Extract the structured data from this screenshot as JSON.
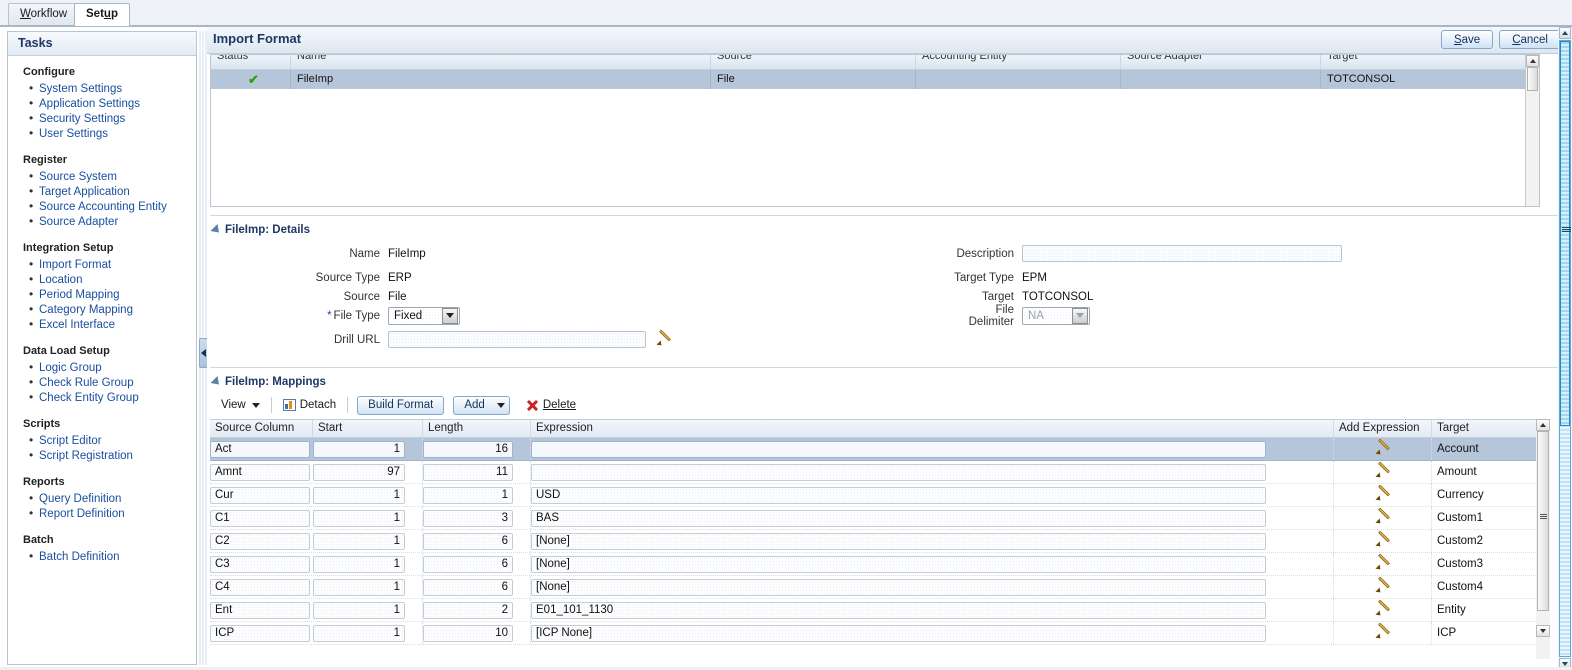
{
  "tabs": [
    {
      "pre": "W",
      "acc": "",
      "label": "Workflow",
      "full": "Workflow",
      "selected": false
    },
    {
      "label": "Setup",
      "selected": true
    }
  ],
  "tab_workflow": {
    "a": "W",
    "b": "orkflow"
  },
  "tab_setup": {
    "a": "Set",
    "b": "u",
    "c": "p"
  },
  "sidebar": {
    "title": "Tasks",
    "groups": [
      {
        "heading": "Configure",
        "items": [
          "System Settings",
          "Application Settings",
          "Security Settings",
          "User Settings"
        ]
      },
      {
        "heading": "Register",
        "items": [
          "Source System",
          "Target Application",
          "Source Accounting Entity",
          "Source Adapter"
        ]
      },
      {
        "heading": "Integration Setup",
        "items": [
          "Import Format",
          "Location",
          "Period Mapping",
          "Category Mapping",
          "Excel Interface"
        ]
      },
      {
        "heading": "Data Load Setup",
        "items": [
          "Logic Group",
          "Check Rule Group",
          "Check Entity Group"
        ]
      },
      {
        "heading": "Scripts",
        "items": [
          "Script Editor",
          "Script Registration"
        ]
      },
      {
        "heading": "Reports",
        "items": [
          "Query Definition",
          "Report Definition"
        ]
      },
      {
        "heading": "Batch",
        "items": [
          "Batch Definition"
        ]
      }
    ]
  },
  "header": {
    "title": "Import Format",
    "save": {
      "a": "S",
      "b": "ave"
    },
    "cancel": {
      "a": "C",
      "b": "ancel"
    }
  },
  "master_grid": {
    "columns": [
      "Status",
      "Name",
      "Source",
      "Accounting Entity",
      "Source Adapter",
      "Target"
    ],
    "rows": [
      {
        "status": "ok",
        "name": "FileImp",
        "source": "File",
        "accounting_entity": "",
        "source_adapter": "",
        "target": "TOTCONSOL",
        "selected": true
      }
    ]
  },
  "details": {
    "section_title": "FileImp: Details",
    "left": {
      "name_label": "Name",
      "name_value": "FileImp",
      "source_type_label": "Source Type",
      "source_type_value": "ERP",
      "source_label": "Source",
      "source_value": "File",
      "file_type_label": "File Type",
      "file_type_value": "Fixed",
      "file_type_required": "*",
      "drill_url_label": "Drill URL",
      "drill_url_value": ""
    },
    "right": {
      "description_label": "Description",
      "description_value": "",
      "target_type_label": "Target Type",
      "target_type_value": "EPM",
      "target_label": "Target",
      "target_value": "TOTCONSOL",
      "file_delimiter_label": "File Delimiter",
      "file_delimiter_value": "NA"
    }
  },
  "mappings": {
    "section_title": "FileImp: Mappings",
    "toolbar": {
      "view": "View",
      "detach": "Detach",
      "build_format": "Build Format",
      "add": "Add",
      "delete": "Delete"
    },
    "columns": [
      "Source Column",
      "Start",
      "Length",
      "Expression",
      "Add Expression",
      "Target"
    ],
    "rows": [
      {
        "source_column": "Act",
        "start": "1",
        "length": "16",
        "expression": "",
        "target": "Account",
        "selected": true
      },
      {
        "source_column": "Amnt",
        "start": "97",
        "length": "11",
        "expression": "",
        "target": "Amount",
        "selected": false
      },
      {
        "source_column": "Cur",
        "start": "1",
        "length": "1",
        "expression": "USD",
        "target": "Currency",
        "selected": false
      },
      {
        "source_column": "C1",
        "start": "1",
        "length": "3",
        "expression": "BAS",
        "target": "Custom1",
        "selected": false
      },
      {
        "source_column": "C2",
        "start": "1",
        "length": "6",
        "expression": "[None]",
        "target": "Custom2",
        "selected": false
      },
      {
        "source_column": "C3",
        "start": "1",
        "length": "6",
        "expression": "[None]",
        "target": "Custom3",
        "selected": false
      },
      {
        "source_column": "C4",
        "start": "1",
        "length": "6",
        "expression": "[None]",
        "target": "Custom4",
        "selected": false
      },
      {
        "source_column": "Ent",
        "start": "1",
        "length": "2",
        "expression": "E01_101_1130",
        "target": "Entity",
        "selected": false
      },
      {
        "source_column": "ICP",
        "start": "1",
        "length": "10",
        "expression": "[ICP None]",
        "target": "ICP",
        "selected": false
      }
    ]
  },
  "colors": {
    "accent": "#1f3864",
    "link": "#1a4fa0",
    "selected_row": "#b6c6da",
    "status_ok": "#2f9b25",
    "delete_x": "#cc2222",
    "scrollbar": "#2e86c1"
  }
}
